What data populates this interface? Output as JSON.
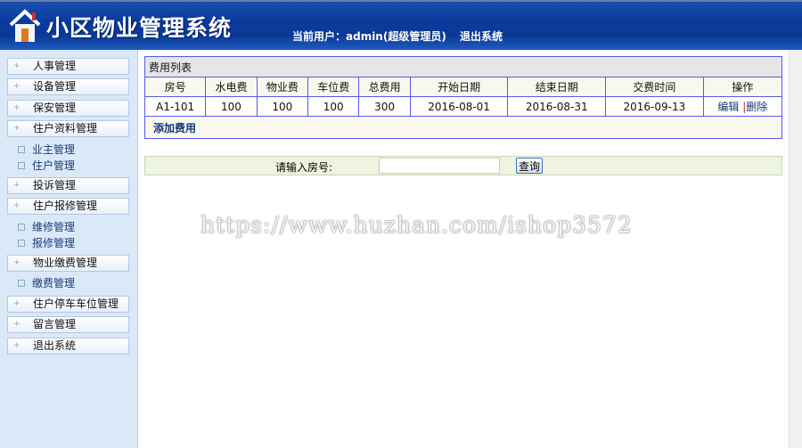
{
  "header": {
    "title": "小区物业管理系统",
    "user_label": "当前用户：admin(超级管理员)",
    "logout": "退出系统"
  },
  "sidebar": {
    "items": [
      {
        "label": "人事管理"
      },
      {
        "label": "设备管理"
      },
      {
        "label": "保安管理"
      },
      {
        "label": "住户资料管理"
      },
      {
        "label": "业主管理"
      },
      {
        "label": "住户管理"
      },
      {
        "label": "投诉管理"
      },
      {
        "label": "住户报修管理"
      },
      {
        "label": "维修管理"
      },
      {
        "label": "报修管理"
      },
      {
        "label": "物业缴费管理"
      },
      {
        "label": "缴费管理"
      },
      {
        "label": "住户停车车位管理"
      },
      {
        "label": "留言管理"
      },
      {
        "label": "退出系统"
      }
    ]
  },
  "table": {
    "caption": "费用列表",
    "headers": [
      "房号",
      "水电费",
      "物业费",
      "车位费",
      "总费用",
      "开始日期",
      "结束日期",
      "交费时间",
      "操作"
    ],
    "rows": [
      {
        "room": "A1-101",
        "utility": "100",
        "property": "100",
        "parking": "100",
        "total": "300",
        "start": "2016-08-01",
        "end": "2016-08-31",
        "paid": "2016-09-13",
        "edit": "编辑",
        "sep": "|",
        "delete": "删除"
      }
    ],
    "add": "添加费用"
  },
  "search": {
    "label": "请输入房号:",
    "value": "",
    "button": "查询"
  },
  "watermark": "https://www.huzhan.com/ishop3572"
}
